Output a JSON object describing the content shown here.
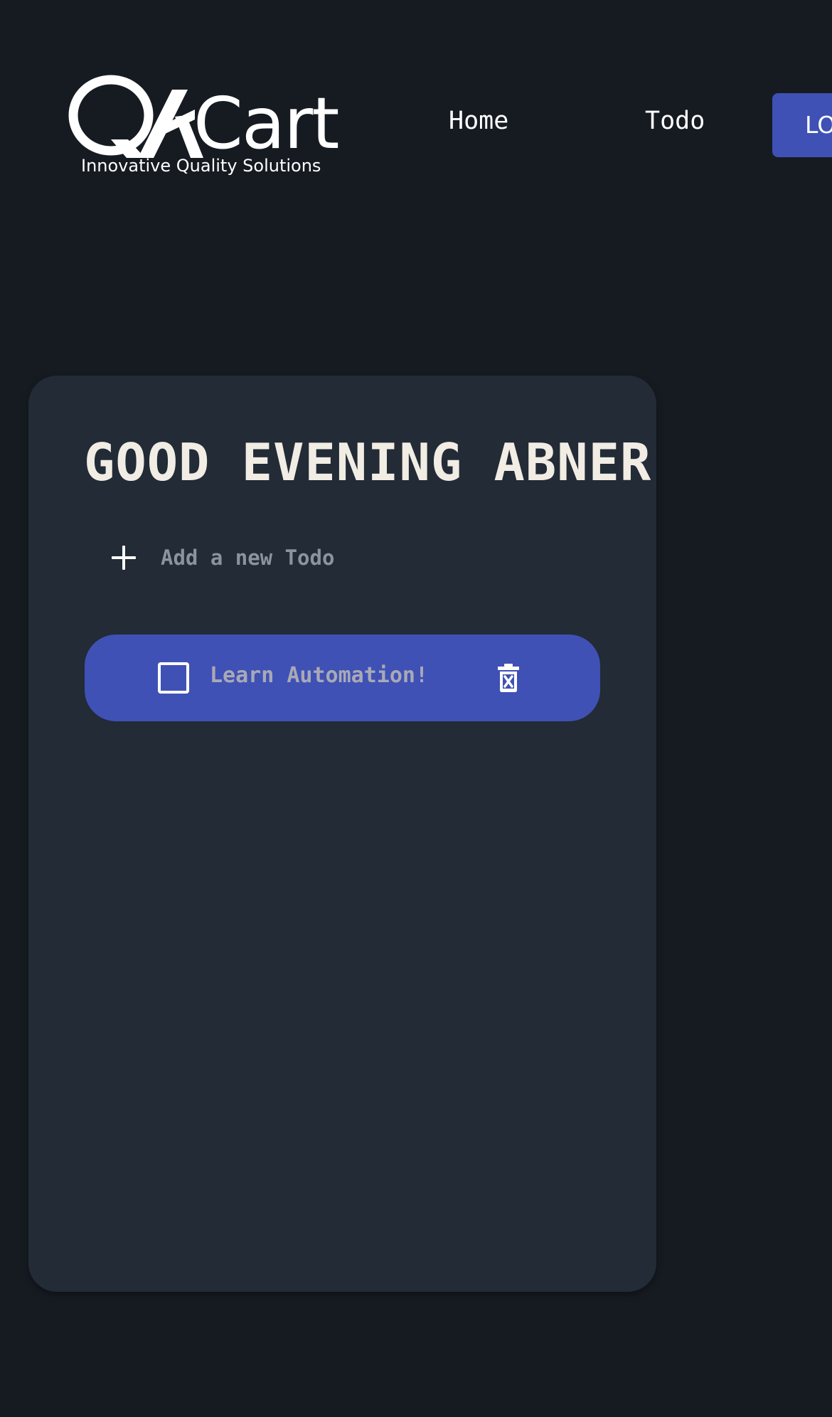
{
  "header": {
    "logo": {
      "wordmark": "QACart",
      "tagline": "Innovative Quality Solutions"
    },
    "nav": {
      "home_label": "Home",
      "todo_label": "Todo",
      "button_label": "LO"
    }
  },
  "main": {
    "greeting": "GOOD EVENING ABNER",
    "new_todo": {
      "placeholder": "Add a new Todo",
      "value": ""
    },
    "todos": [
      {
        "text": "Learn Automation!",
        "completed": false
      }
    ]
  },
  "colors": {
    "background": "#161b22",
    "card": "#222b36",
    "accent": "#3f51b5",
    "heading": "#f1ede4",
    "placeholder": "#8b949e"
  },
  "icons": [
    "plus-icon",
    "checkbox-icon",
    "trash-icon"
  ]
}
